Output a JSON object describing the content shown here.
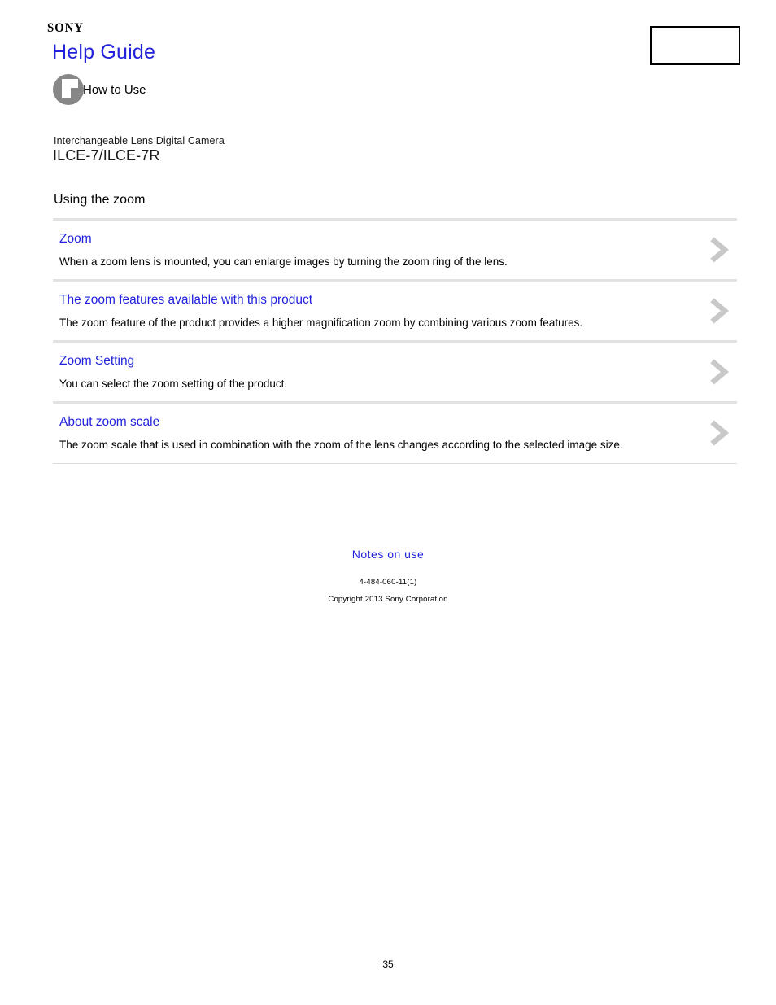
{
  "header": {
    "brand": "SONY",
    "title": "Help Guide",
    "mode_label": "How to Use",
    "mode_icon": "how-to-use-icon",
    "corner_box_label": "",
    "title_color": "#2222dd"
  },
  "product": {
    "category": "Interchangeable Lens Digital Camera",
    "model": "ILCE-7/ILCE-7R"
  },
  "section": {
    "title": "Using the zoom"
  },
  "topics": [
    {
      "link": "Zoom",
      "description": "When a zoom lens is mounted, you can enlarge images by turning the zoom ring of the lens.",
      "chevron_icon": "chevron-right-icon"
    },
    {
      "link": "The zoom features available with this product",
      "description": "The zoom feature of the product provides a higher magnification zoom by combining various zoom features.",
      "chevron_icon": "chevron-right-icon"
    },
    {
      "link": "Zoom Setting",
      "description": "You can select the zoom setting of the product.",
      "chevron_icon": "chevron-right-icon"
    },
    {
      "link": "About zoom scale",
      "description": "The zoom scale that is used in combination with the zoom of the lens changes according to the selected image size.",
      "chevron_icon": "chevron-right-icon"
    }
  ],
  "footer": {
    "notes_link": "Notes on use",
    "doc_code": "4-484-060-11(1)",
    "copyright": "Copyright 2013 Sony Corporation",
    "page_number": "35"
  },
  "colors": {
    "link": "#2222dd",
    "chevron": "#c8c8c8",
    "divider": "#e2e2e2",
    "icon_gray": "#878787"
  }
}
